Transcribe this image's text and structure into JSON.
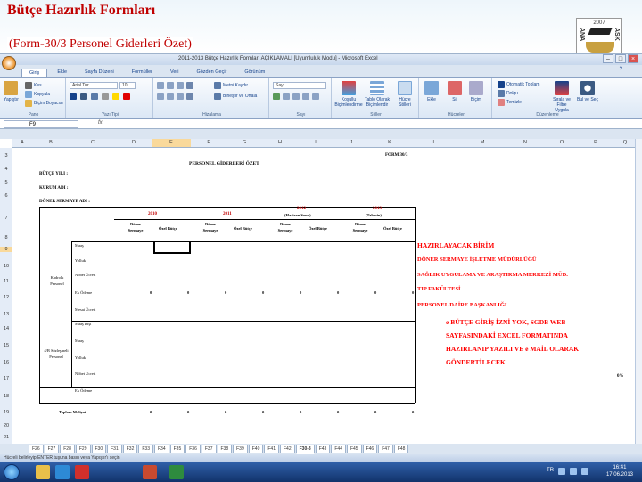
{
  "slide": {
    "title": "Bütçe Hazırlık Formları",
    "subtitle": "(Form-30/3 Personel Giderleri Özet)",
    "logo_year": "2007",
    "logo_side_left": "ANA",
    "logo_side_right": "ASK"
  },
  "window": {
    "title": "2011-2013 Bütçe Hazırlık Formları AÇIKLAMALI [Uyumluluk Modu] - Microsoft Excel"
  },
  "ribbon": {
    "tabs": [
      "Giriş",
      "Ekle",
      "Sayfa Düzeni",
      "Formüller",
      "Veri",
      "Gözden Geçir",
      "Görünüm"
    ],
    "groups": {
      "clipboard": {
        "label": "Pano",
        "paste": "Yapıştır",
        "cut": "Kes",
        "copy": "Kopyala",
        "format_painter": "Biçim Boyacısı"
      },
      "font": {
        "label": "Yazı Tipi",
        "font_name": "Arial Tur",
        "font_size": "10"
      },
      "alignment": {
        "label": "Hizalama",
        "wrap": "Metni Kaydır",
        "merge": "Birleştir ve Ortala"
      },
      "number": {
        "label": "Sayı",
        "format": "Sayı"
      },
      "styles": {
        "label": "Stiller",
        "conditional": "Koşullu Biçimlendirme",
        "table": "Tablo Olarak Biçimlendir",
        "cell": "Hücre Stilleri"
      },
      "cells": {
        "label": "Hücreler",
        "insert": "Ekle",
        "delete": "Sil",
        "format": "Biçim"
      },
      "editing": {
        "label": "Düzenleme",
        "autosum": "Otomatik Toplam",
        "fill": "Dolgu",
        "clear": "Temizle",
        "sort": "Sırala ve Filtre Uygula",
        "find": "Bul ve Seç"
      }
    }
  },
  "formula_bar": {
    "name_box": "F9",
    "fx": "fx",
    "value": ""
  },
  "columns": [
    "A",
    "B",
    "C",
    "D",
    "E",
    "F",
    "G",
    "H",
    "I",
    "J",
    "K",
    "L",
    "M",
    "N",
    "O",
    "P",
    "Q",
    "R",
    "S"
  ],
  "selected_column": "E",
  "rows": [
    "3",
    "4",
    "5",
    "6",
    "7",
    "8",
    "9",
    "10",
    "11",
    "12",
    "13",
    "14",
    "15",
    "16",
    "17",
    "18",
    "19",
    "20",
    "21",
    "22",
    "23",
    "24"
  ],
  "selected_row": "9",
  "form": {
    "title": "PERSONEL GİDERLERİ ÖZET",
    "form_no": "FORM 30/3",
    "budget_year": "BÜTÇE YILI :",
    "institution": "KURUM ADI :",
    "revolving_fund": "DÖNER SERMAYE ADI :",
    "years": {
      "y2010": "2010",
      "y2011": "2011",
      "y2012": "2012",
      "y2012_note": "(Haziran Sonu)",
      "y2013": "2013",
      "y2013_note": "(Tahmin)"
    },
    "col_headers": {
      "doner": "Döner Sermaye",
      "ozel": "Özel Bütçe"
    },
    "group_kadrolu": "Kadrolu Personel",
    "group_sozlesmeli": "4/B Sözleşmeli Personel",
    "rows_kadrolu": [
      "Maaş",
      "Yolluk",
      "Nöbet Ücreti",
      "Ek Ödeme",
      "Mesai Ücreti",
      "Maaş Dışı"
    ],
    "rows_sozlesmeli": [
      "Maaş",
      "Yolluk",
      "Nöbet Ücreti",
      "Ek Ödeme"
    ],
    "total_label": "Toplam Maliyet",
    "zero": "0",
    "stray_value": "0%"
  },
  "annotations": {
    "preparing_unit_label": "HAZIRLAYACAK BİRİM",
    "unit_1": "DÖNER SERMAYE İŞLETME MÜDÜRLÜĞÜ",
    "unit_2": "SAĞLIK UYGULAMA VE ARAŞTIRMA MERKEZİ MÜD.",
    "unit_3": "TIP FAKÜLTESİ",
    "unit_4": "PERSONEL DAİRE BAŞKANLIĞI",
    "note_line_1": "e BÜTÇE GİRİŞ İZNİ YOK, SGDB WEB",
    "note_line_2": "SAYFASINDAKİ EXCEL FORMATINDA",
    "note_line_3": "HAZIRLANIP YAZILI VE e MAİL OLARAK",
    "note_line_4": "GÖNDERTİLECEK"
  },
  "sheet_tabs": [
    "F26",
    "F27",
    "F28",
    "F29",
    "F30",
    "F31",
    "F32",
    "F33",
    "F34",
    "F35",
    "F36",
    "F37",
    "F38",
    "F39",
    "F40",
    "F41",
    "F42",
    "F30-3",
    "F43",
    "F44",
    "F45",
    "F46",
    "F47",
    "F48"
  ],
  "active_sheet": "F30-3",
  "status_bar": "Hücreli belirleyip ENTER tuşuna basın veya Yapıştır'ı seçin",
  "taskbar": {
    "lang": "TR",
    "time": "16:41",
    "date": "17.06.2013"
  }
}
